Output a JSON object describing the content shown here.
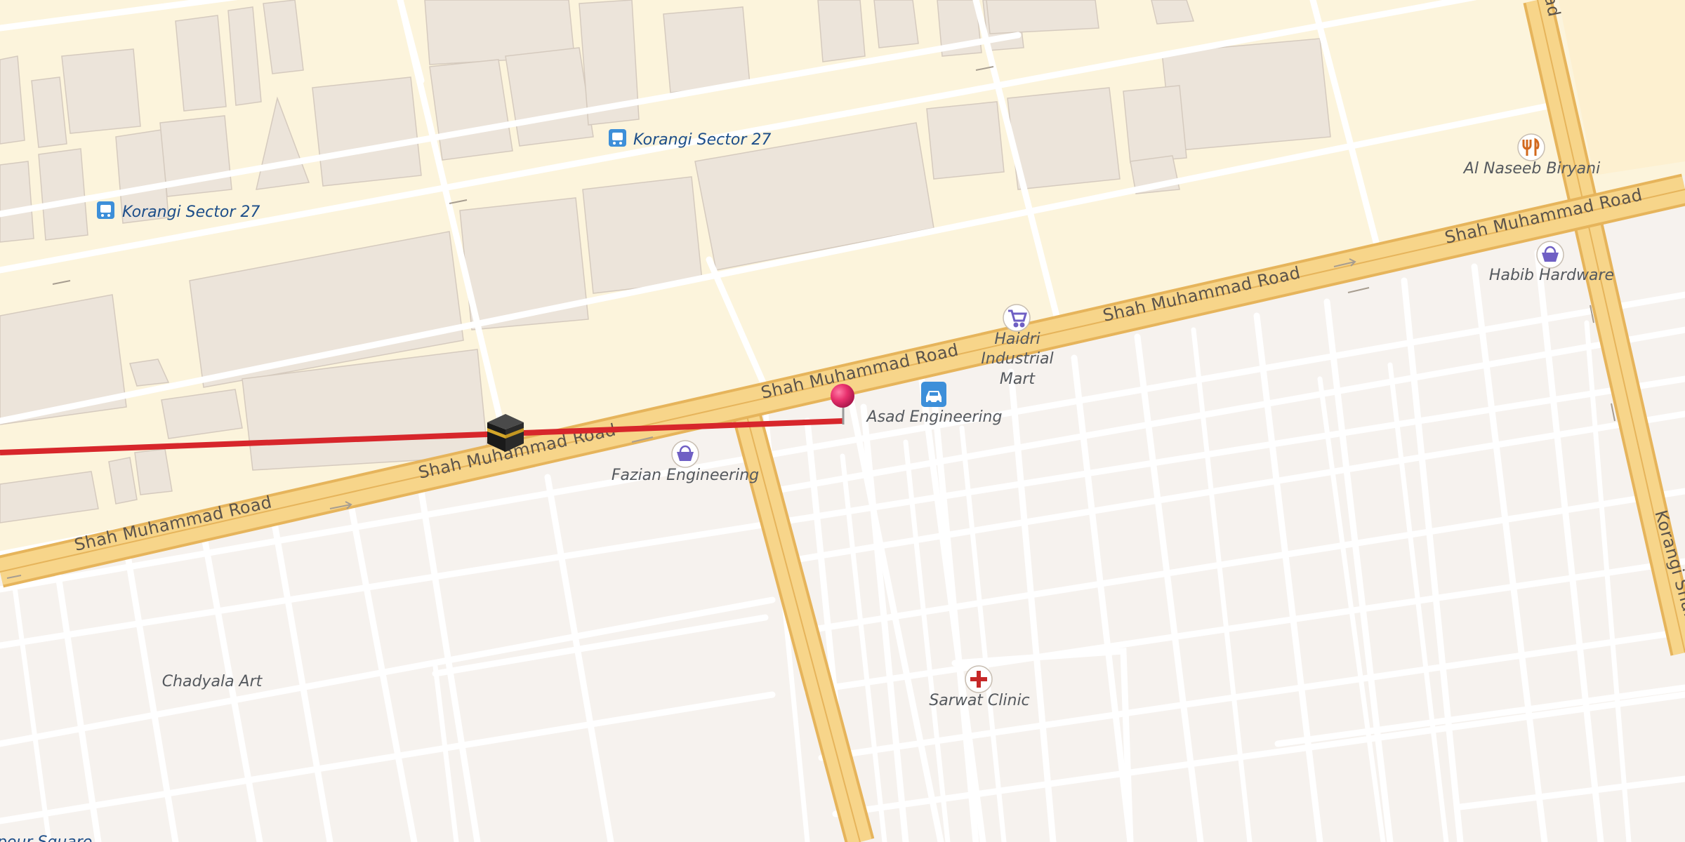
{
  "map": {
    "roads": {
      "main_road_labels": [
        "Shah Muhammad Road",
        "Shah Muhammad Road",
        "Shah Muhammad Road",
        "Shah Muhammad Road",
        "Shah Muhammad Road"
      ],
      "side_road_label": "Korangi Shahrah",
      "top_corner_road_fragment": "ad"
    },
    "pois": {
      "bus_stop_1": "Korangi Sector 27",
      "bus_stop_2": "Korangi Sector 27",
      "restaurant": "Al Naseeb Biryani",
      "hardware": "Habib Hardware",
      "mart": [
        "Haidri",
        "Industrial",
        "Mart"
      ],
      "car_service": "Asad Engineering",
      "shop": "Fazian Engineering",
      "art": "Chadyala Art",
      "clinic": "Sarwat Clinic",
      "square": "pour Square"
    },
    "icons": {
      "bus": "bus-icon",
      "restaurant": "fork-knife-icon",
      "shop": "shopping-basket-icon",
      "mart": "shopping-cart-icon",
      "car": "car-icon",
      "clinic": "medical-cross-icon",
      "pin": "location-pin-icon",
      "kaaba": "kaaba-icon"
    },
    "colors": {
      "industrial_area": "#fcf4dc",
      "residential_area": "#f6f2ee",
      "major_road": "#f7d58a",
      "major_road_casing": "#e6b45b",
      "minor_road": "#ffffff",
      "qibla_line": "#d7262b",
      "pin": "#e8306d"
    }
  }
}
